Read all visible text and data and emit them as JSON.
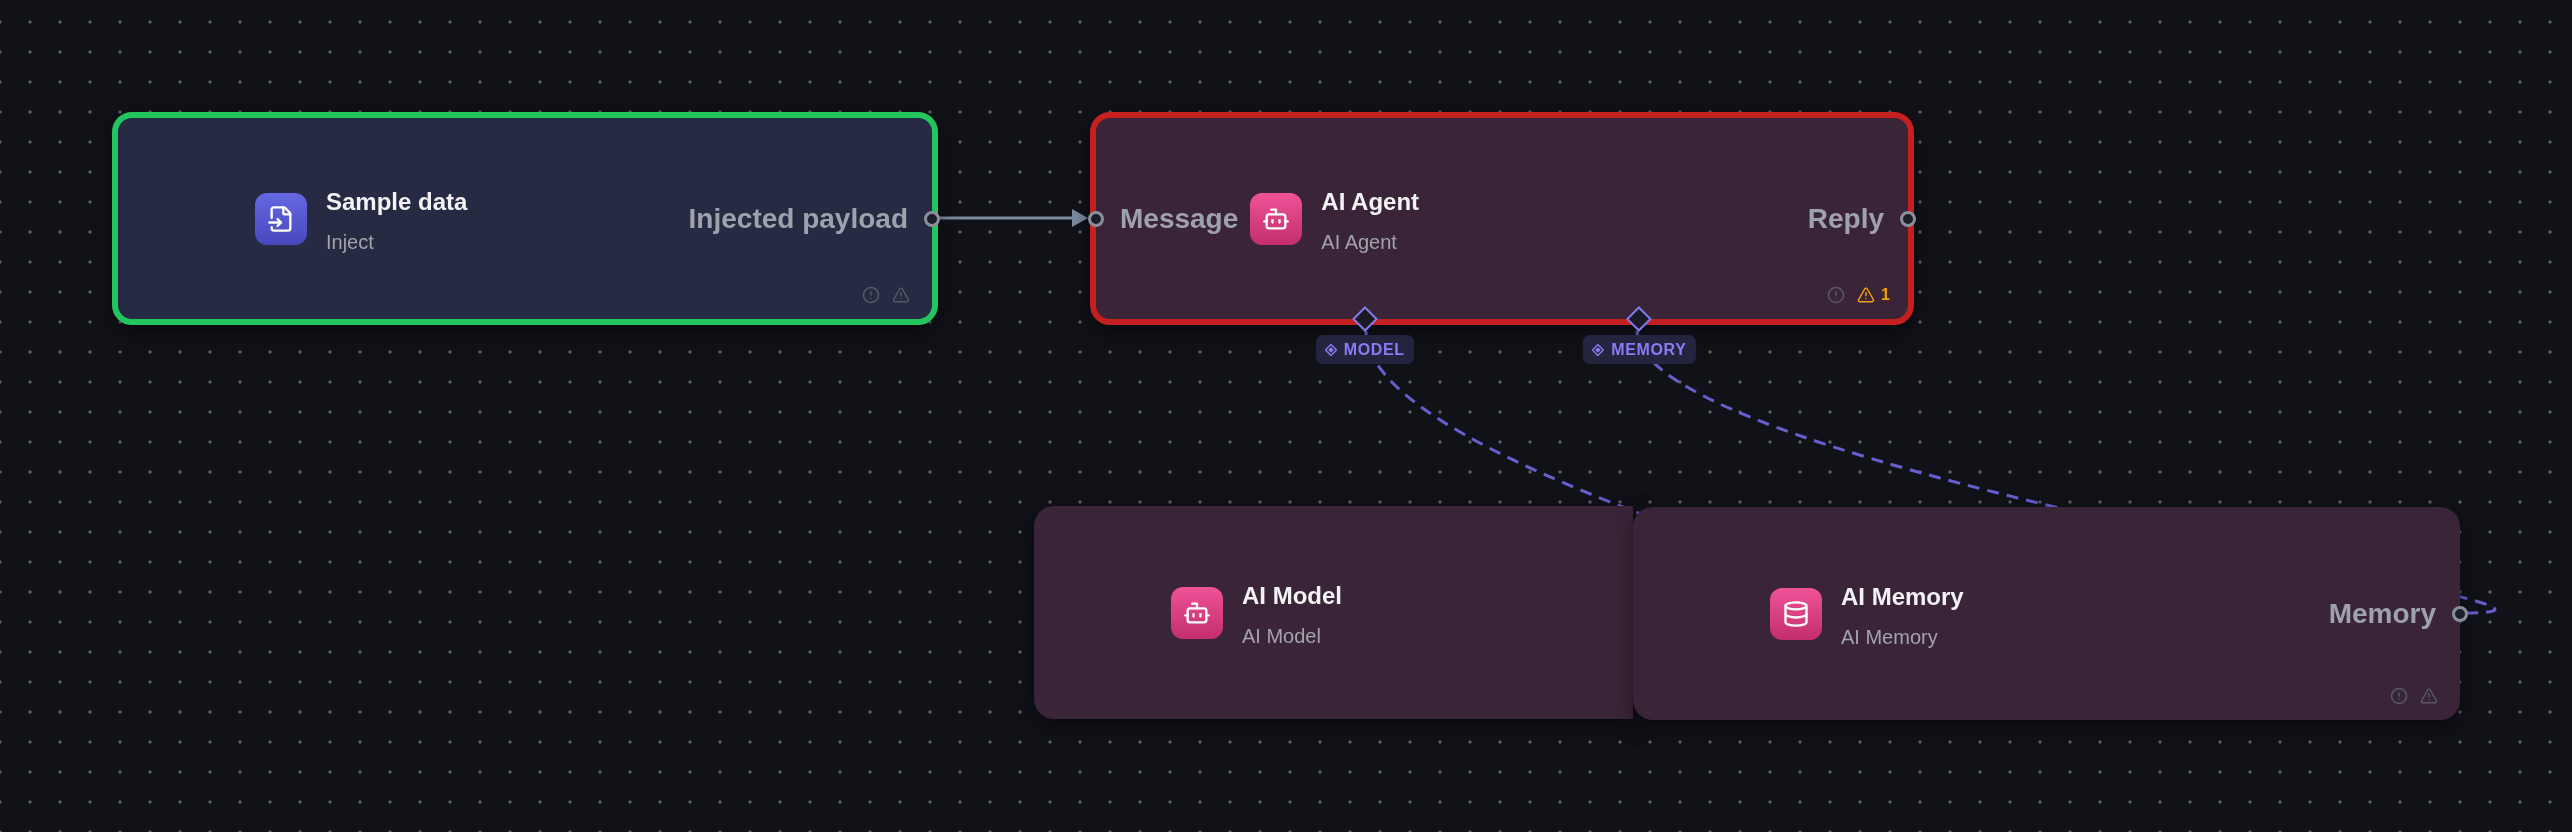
{
  "canvas": {
    "nodes": [
      {
        "kind": "inject",
        "color": "#22c55e",
        "title": "Sample data",
        "subtitle": "Inject",
        "outputs": [
          "Injected payload"
        ],
        "issue_icons": true
      },
      {
        "kind": "agent",
        "color": "#c4201f",
        "title": "AI Agent",
        "subtitle": "AI Agent",
        "inputs": [
          "Message"
        ],
        "outputs": [
          "Reply"
        ],
        "issue_icons": true,
        "warning_count": "1",
        "bottom_ports": [
          "MODEL",
          "MEMORY"
        ]
      },
      {
        "kind": "model",
        "title": "AI Model",
        "subtitle": "AI Model"
      },
      {
        "kind": "memory",
        "title": "AI Memory",
        "subtitle": "AI Memory",
        "outputs": [
          "Memory"
        ],
        "issue_icons": true
      }
    ],
    "connections": [
      {
        "kind": "solid"
      },
      {
        "kind": "dashed"
      },
      {
        "kind": "dashed"
      }
    ]
  }
}
